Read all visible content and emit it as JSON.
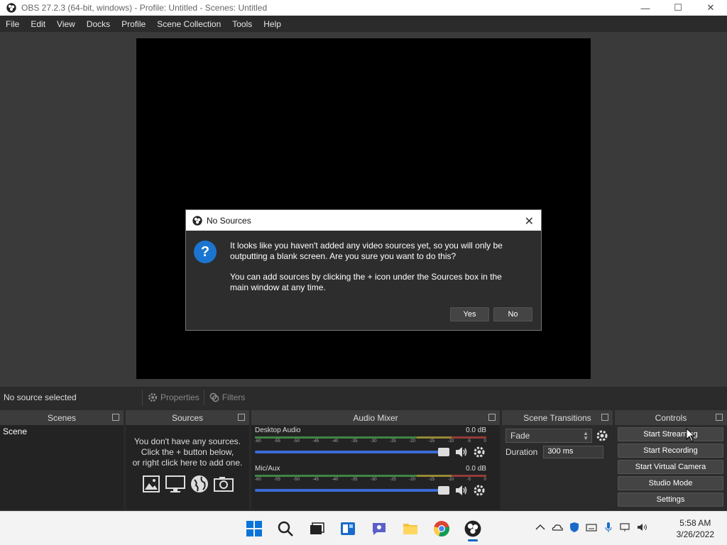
{
  "window": {
    "title": "OBS 27.2.3 (64-bit, windows) - Profile: Untitled - Scenes: Untitled",
    "minimize": "—",
    "maximize": "☐",
    "close": "✕"
  },
  "menu": [
    "File",
    "Edit",
    "View",
    "Docks",
    "Profile",
    "Scene Collection",
    "Tools",
    "Help"
  ],
  "source_bar": {
    "status": "No source selected",
    "properties": "Properties",
    "filters": "Filters"
  },
  "docks": {
    "scenes": {
      "title": "Scenes",
      "items": [
        "Scene"
      ]
    },
    "sources": {
      "title": "Sources",
      "empty_line1": "You don't have any sources.",
      "empty_line2": "Click the + button below,",
      "empty_line3": "or right click here to add one."
    },
    "mixer": {
      "title": "Audio Mixer",
      "channels": [
        {
          "name": "Desktop Audio",
          "level": "0.0 dB"
        },
        {
          "name": "Mic/Aux",
          "level": "0.0 dB"
        }
      ],
      "ticks": [
        "-60",
        "-55",
        "-50",
        "-45",
        "-40",
        "-35",
        "-30",
        "-25",
        "-20",
        "-15",
        "-10",
        "-5",
        "0"
      ]
    },
    "transitions": {
      "title": "Scene Transitions",
      "selected": "Fade",
      "duration_label": "Duration",
      "duration_value": "300 ms"
    },
    "controls": {
      "title": "Controls",
      "buttons": [
        "Start Streaming",
        "Start Recording",
        "Start Virtual Camera",
        "Studio Mode",
        "Settings"
      ]
    }
  },
  "dialog": {
    "title": "No Sources",
    "icon": "?",
    "close": "✕",
    "paragraph1": "It looks like you haven't added any video sources yet, so you will only be outputting a blank screen. Are you sure you want to do this?",
    "paragraph2": "You can add sources by clicking the + icon under the Sources box in the main window at any time.",
    "yes": "Yes",
    "no": "No"
  },
  "taskbar": {
    "time": "5:58 AM",
    "date": "3/26/2022"
  },
  "colors": {
    "accent": "#1b75d0",
    "dock_bg": "#2b2b2b",
    "panel_bg": "#232323"
  }
}
